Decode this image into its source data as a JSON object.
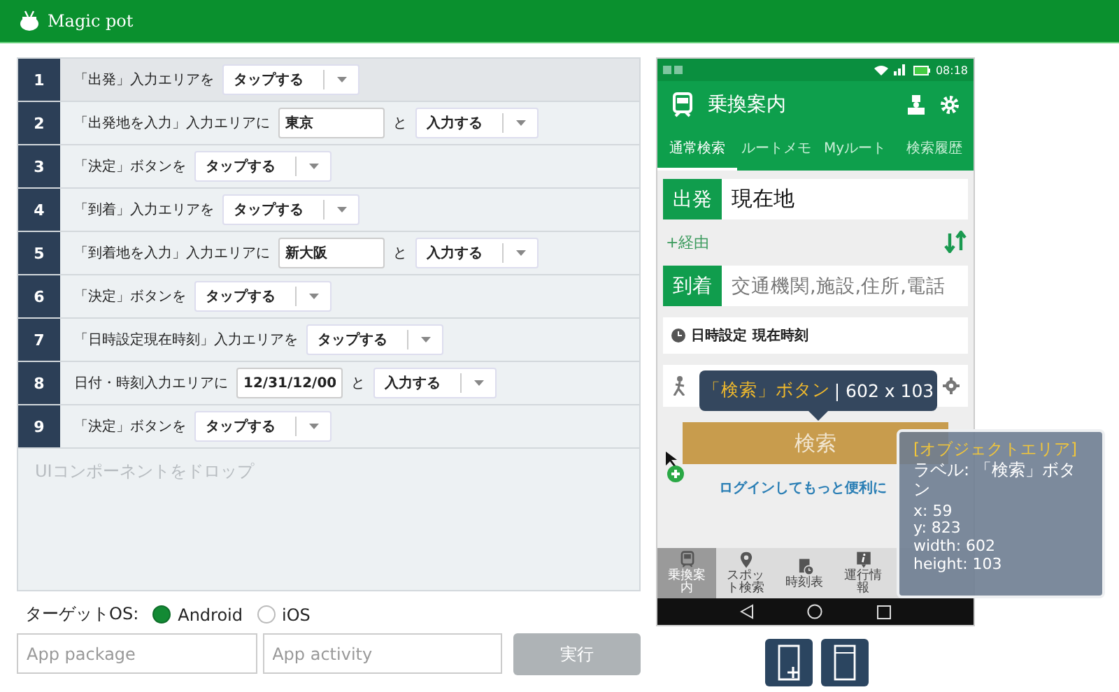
{
  "app": {
    "title": "Magic pot"
  },
  "steps": [
    {
      "number": "1",
      "parts": [
        {
          "kind": "text",
          "text": "「出発」入力エリアを"
        },
        {
          "kind": "select",
          "value": "タップする"
        }
      ]
    },
    {
      "number": "2",
      "parts": [
        {
          "kind": "text",
          "text": "「出発地を入力」入力エリアに"
        },
        {
          "kind": "input",
          "value": "東京"
        },
        {
          "kind": "text",
          "text": "と"
        },
        {
          "kind": "select",
          "value": "入力する"
        }
      ]
    },
    {
      "number": "3",
      "parts": [
        {
          "kind": "text",
          "text": "「決定」ボタンを"
        },
        {
          "kind": "select",
          "value": "タップする"
        }
      ]
    },
    {
      "number": "4",
      "parts": [
        {
          "kind": "text",
          "text": "「到着」入力エリアを"
        },
        {
          "kind": "select",
          "value": "タップする"
        }
      ]
    },
    {
      "number": "5",
      "parts": [
        {
          "kind": "text",
          "text": "「到着地を入力」入力エリアに"
        },
        {
          "kind": "input",
          "value": "新大阪"
        },
        {
          "kind": "text",
          "text": "と"
        },
        {
          "kind": "select",
          "value": "入力する"
        }
      ]
    },
    {
      "number": "6",
      "parts": [
        {
          "kind": "text",
          "text": "「決定」ボタンを"
        },
        {
          "kind": "select",
          "value": "タップする"
        }
      ]
    },
    {
      "number": "7",
      "parts": [
        {
          "kind": "text",
          "text": "「日時設定現在時刻」入力エリアを"
        },
        {
          "kind": "select",
          "value": "タップする"
        }
      ]
    },
    {
      "number": "8",
      "parts": [
        {
          "kind": "text",
          "text": "日付・時刻入力エリアに"
        },
        {
          "kind": "input",
          "value": "12/31/12/00"
        },
        {
          "kind": "text",
          "text": "と"
        },
        {
          "kind": "select",
          "value": "入力する"
        }
      ]
    },
    {
      "number": "9",
      "parts": [
        {
          "kind": "text",
          "text": "「決定」ボタンを"
        },
        {
          "kind": "select",
          "value": "タップする"
        }
      ]
    }
  ],
  "drop_hint": "UIコンポーネントをドロップ",
  "target_os": {
    "label": "ターゲットOS:",
    "options": [
      {
        "label": "Android",
        "selected": true
      },
      {
        "label": "iOS",
        "selected": false
      }
    ]
  },
  "fields": [
    {
      "placeholder": "App package"
    },
    {
      "placeholder": "App activity"
    }
  ],
  "run_button": {
    "label": "実行",
    "disabled": true
  },
  "phone": {
    "status_time": "08:18",
    "app_title": "乗換案内",
    "tabs": [
      {
        "label": "通常検索",
        "selected": true
      },
      {
        "label": "ルートメモ",
        "selected": false
      },
      {
        "label": "Myルート",
        "selected": false
      },
      {
        "label": "検索履歴",
        "selected": false
      }
    ],
    "departure": {
      "label": "出発",
      "value": "現在地"
    },
    "via": "+経由",
    "arrival": {
      "label": "到着",
      "placeholder": "交通機関,施設,住所,電話"
    },
    "datetime": {
      "label": "日時設定",
      "value": "現在時刻"
    },
    "search_button": "検索",
    "login_link": "ログインしてもっと便利に",
    "nav": [
      {
        "kind": "train",
        "label": "乗換案内",
        "selected": true
      },
      {
        "kind": "pin",
        "label": "スポット検索",
        "selected": false
      },
      {
        "kind": "timetable",
        "label": "時刻表",
        "selected": false
      },
      {
        "kind": "info",
        "label": "運行情報",
        "selected": false
      }
    ]
  },
  "tooltip": {
    "name": "「検索」ボタン",
    "size": "| 602 x 103"
  },
  "inspector": {
    "title": "[オブジェクトエリア]",
    "lines": [
      "ラベル: 「検索」ボタン",
      "x: 59",
      "y: 823",
      "width: 602",
      "height: 103"
    ]
  }
}
